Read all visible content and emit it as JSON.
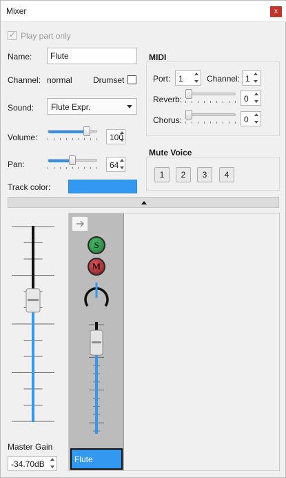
{
  "window": {
    "title": "Mixer",
    "close_glyph": "x"
  },
  "part": {
    "play_part_only_label": "Play part only",
    "play_part_only_checked": true,
    "name_label": "Name:",
    "name_value": "Flute",
    "channel_label": "Channel:",
    "channel_value": "normal",
    "drumset_label": "Drumset",
    "drumset_checked": false,
    "sound_label": "Sound:",
    "sound_value": "Flute Expr.",
    "volume_label": "Volume:",
    "volume_value": "100",
    "volume_fraction": 0.787,
    "pan_label": "Pan:",
    "pan_value": "64",
    "pan_fraction": 0.504,
    "track_color_label": "Track color:",
    "track_color": "#3399f0"
  },
  "midi": {
    "title": "MIDI",
    "port_label": "Port:",
    "port_value": "1",
    "channel_label": "Channel:",
    "channel_value": "1",
    "reverb_label": "Reverb:",
    "reverb_value": "0",
    "chorus_label": "Chorus:",
    "chorus_value": "0"
  },
  "mute_voice": {
    "title": "Mute Voice",
    "voices": [
      "1",
      "2",
      "3",
      "4"
    ]
  },
  "master": {
    "gain_label": "Master Gain",
    "gain_value": "-34.70dB",
    "level_fraction": 0.62
  },
  "channel_strip": {
    "expand_icon": "arrow-right-icon",
    "solo_label": "S",
    "mute_label": "M",
    "name": "Flute",
    "level_fraction": 0.82
  },
  "colors": {
    "accent": "#3399f0",
    "solo": "#2f9a4d",
    "mute": "#b8333a"
  }
}
